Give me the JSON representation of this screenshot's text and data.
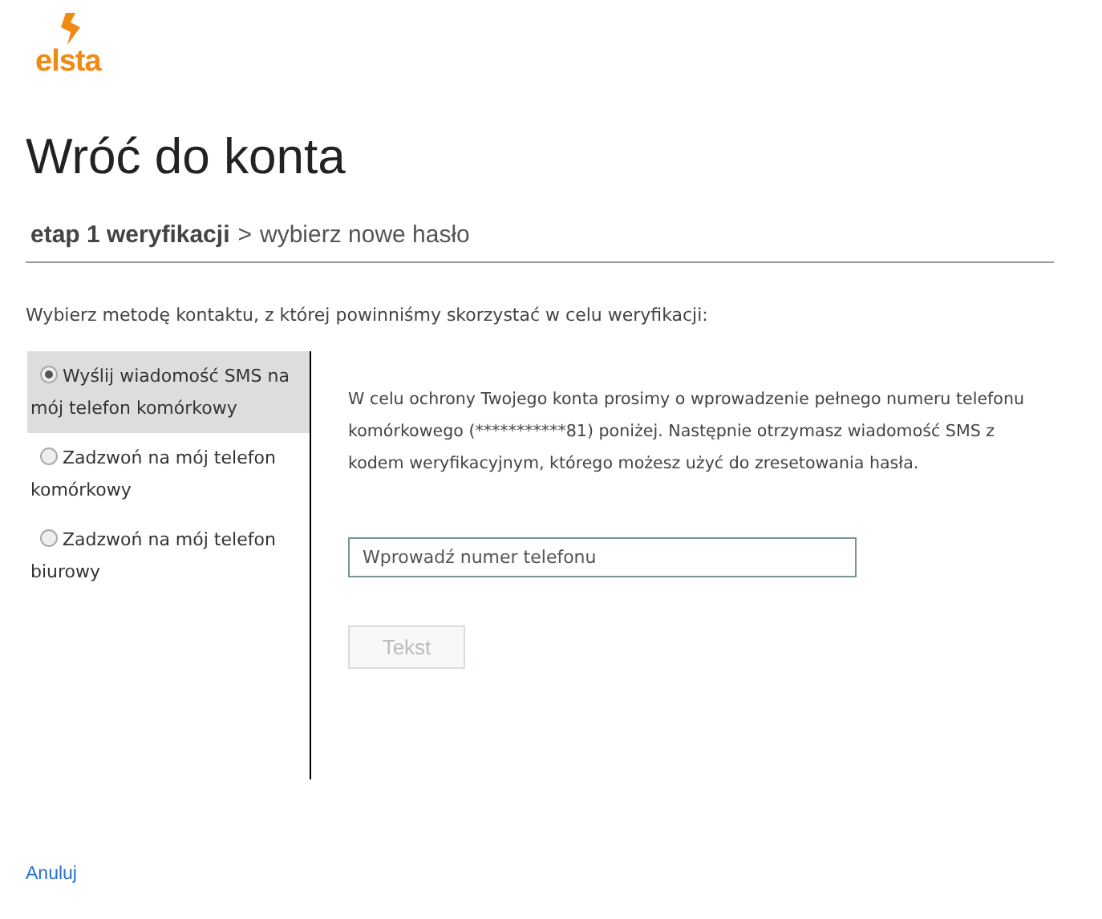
{
  "logo": {
    "text": "elsta"
  },
  "title": "Wróć do konta",
  "breadcrumb": {
    "current": "etap 1 weryfikacji",
    "separator": ">",
    "next": "wybierz nowe hasło"
  },
  "instruction": "Wybierz metodę kontaktu, z której powinniśmy skorzystać w celu weryfikacji:",
  "methods": [
    {
      "label": "Wyślij wiadomość SMS na mój telefon komórkowy",
      "selected": true
    },
    {
      "label": "Zadzwoń na mój telefon komórkowy",
      "selected": false
    },
    {
      "label": "Zadzwoń na mój telefon biurowy",
      "selected": false
    }
  ],
  "description": "W celu ochrony Twojego konta prosimy o wprowadzenie pełnego numeru telefonu komórkowego (***********81) poniżej. Następnie otrzymasz wiadomość SMS z kodem weryfikacyjnym, którego możesz użyć do zresetowania hasła.",
  "phone_field": {
    "placeholder": "Wprowadź numer telefonu"
  },
  "submit_button": {
    "label": "Tekst",
    "disabled": true
  },
  "cancel_link": "Anuluj"
}
